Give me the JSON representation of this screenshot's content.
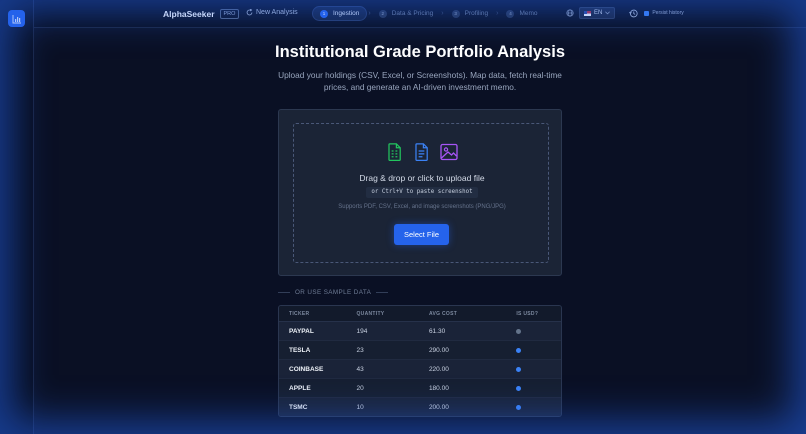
{
  "header": {
    "brand": "AlphaSeeker",
    "brand_badge": "PRO",
    "new_analysis_label": "New Analysis",
    "steps": [
      {
        "num": "1",
        "label": "Ingestion",
        "active": true
      },
      {
        "num": "2",
        "label": "Data & Pricing",
        "active": false
      },
      {
        "num": "3",
        "label": "Profiling",
        "active": false
      },
      {
        "num": "4",
        "label": "Memo",
        "active": false
      }
    ],
    "step_separator": "›",
    "language": "EN",
    "persist_label": "Persist history",
    "persist_checked": true
  },
  "hero": {
    "title": "Institutional Grade Portfolio Analysis",
    "subtitle": "Upload your holdings (CSV, Excel, or Screenshots). Map data, fetch real-time prices, and generate an AI-driven investment memo."
  },
  "upload": {
    "drag_text": "Drag & drop or click to upload file",
    "paste_hint": "or Ctrl+V to paste screenshot",
    "supports_text": "Supports PDF, CSV, Excel, and image screenshots (PNG/JPG)",
    "button_label": "Select File"
  },
  "sample": {
    "label": "OR USE SAMPLE DATA",
    "columns": [
      "TICKER",
      "QUANTITY",
      "AVG COST",
      "IS USD?"
    ],
    "rows": [
      {
        "ticker": "PAYPAL",
        "quantity": "194",
        "avg_cost": "61.30",
        "is_usd": false
      },
      {
        "ticker": "TESLA",
        "quantity": "23",
        "avg_cost": "290.00",
        "is_usd": true
      },
      {
        "ticker": "COINBASE",
        "quantity": "43",
        "avg_cost": "220.00",
        "is_usd": true
      },
      {
        "ticker": "APPLE",
        "quantity": "20",
        "avg_cost": "180.00",
        "is_usd": true
      },
      {
        "ticker": "TSMC",
        "quantity": "10",
        "avg_cost": "200.00",
        "is_usd": true
      }
    ]
  },
  "colors": {
    "accent": "#2563eb",
    "usd_true": "#3b82f6",
    "usd_false": "#64748b",
    "icon_csv": "#22c55e",
    "icon_doc": "#3b82f6",
    "icon_image": "#a855f7"
  }
}
